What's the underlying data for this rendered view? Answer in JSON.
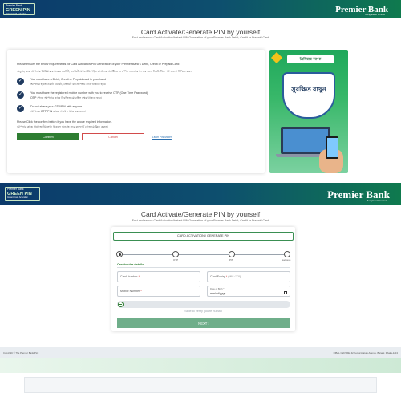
{
  "colors": {
    "header_start": "#0c3a6b",
    "header_end": "#0f7a4e",
    "confirm": "#2e7d32",
    "cancel": "#d24b4b",
    "next": "#6fae8a"
  },
  "top": {
    "logo": {
      "line1": "Premier Bank",
      "line2": "GREEN PIN",
      "line3": "Instant Card Activation"
    },
    "brand": "Premier Bank",
    "brand_sub": "Bangladesh Limited",
    "title": "Card Activate/Generate PIN by yourself",
    "subtitle": "Fast and secure Card Activation/Instant PIN Generation of your Premier Bank Debit, Credit or Prepaid Card",
    "intro_en": "Please ensure the below requirements for Card Activation/PIN Generation of your Premier Bank's Debit, Credit or Prepaid Card:",
    "intro_bn": "অনুগ্রহ করে আপনার প্রিমিয়ার ব্যাংকের ডেবিট, ক্রেডিট অথবা প্রিপেইড কার্ড এর অ্যাক্টিভেশন / পিন জেনারেশন এর জন্য নিম্নলিখিত শর্ত গুলো নিশ্চিত করুন",
    "requirements": [
      {
        "en": "You must have a Debit, Credit or Prepaid card in your hand",
        "bn": "আপনার হাতে একটি ডেবিট, ক্রেডিট বা প্রিপেইড কার্ড থাকতে হবে।"
      },
      {
        "en": "You must have the registered mobile number with you to receive OTP (One Time Password)",
        "bn": "OTP পেতে আপনার কাছে নিবন্ধিত মোবাইল নম্বর থাকতে হবে।"
      },
      {
        "en": "Do not share your OTP/PIN with anyone.",
        "bn": "আপনার OTP/PIN কারো সাথে শেয়ার করবেন না।"
      }
    ],
    "note_en": "Please Click the confirm button if you have the above required information.",
    "note_bn": "আপনার কাছে প্রয়োজনীয় তথ্য থাকলে অনুগ্রহ করে কনফার্ম বোতামে ক্লিক করুন।",
    "confirm_label": "Confirm",
    "cancel_label": "Cancel",
    "learn_link": "Learn PIN Mailer",
    "promo": {
      "bank": "প্রিমিয়ার ব্যাংক",
      "slogan": "সুরক্ষিত রাখুন"
    }
  },
  "bottom": {
    "logo": {
      "line1": "Premier Bank",
      "line2": "GREEN PIN",
      "line3": "Instant Card Activation"
    },
    "brand": "Premier Bank",
    "brand_sub": "Bangladesh Limited",
    "title": "Card Activate/Generate PIN by yourself",
    "subtitle": "Fast and secure Card Activation/Instant PIN Generation of your Premier Bank Debit, Credit or Prepaid Card",
    "tab_label": "CARD ACTIVATION / GENERATE PIN",
    "steps": [
      "",
      "OTP",
      "PIN",
      "Success"
    ],
    "active_step": 1,
    "section_label": "Cardholder details",
    "fields": {
      "card_number": {
        "label": "Card Number",
        "required": "*"
      },
      "card_expiry": {
        "label": "Card Expiry",
        "required": "*",
        "hint": "(MM / YY)"
      },
      "mobile_number": {
        "label": "Mobile Number",
        "required": "*"
      },
      "dob": {
        "mini": "Date of Birth *",
        "value": "mm/dd/yyyy"
      }
    },
    "slide_text": "Slide to verify you're human",
    "next_label": "NEXT ›"
  },
  "footer": {
    "left": "Copyright © The Premier Bank PLC",
    "right": "IQBAL CENTRE, 42 Kemal Ataturk Avenue, Banani, Dhaka-1213"
  }
}
